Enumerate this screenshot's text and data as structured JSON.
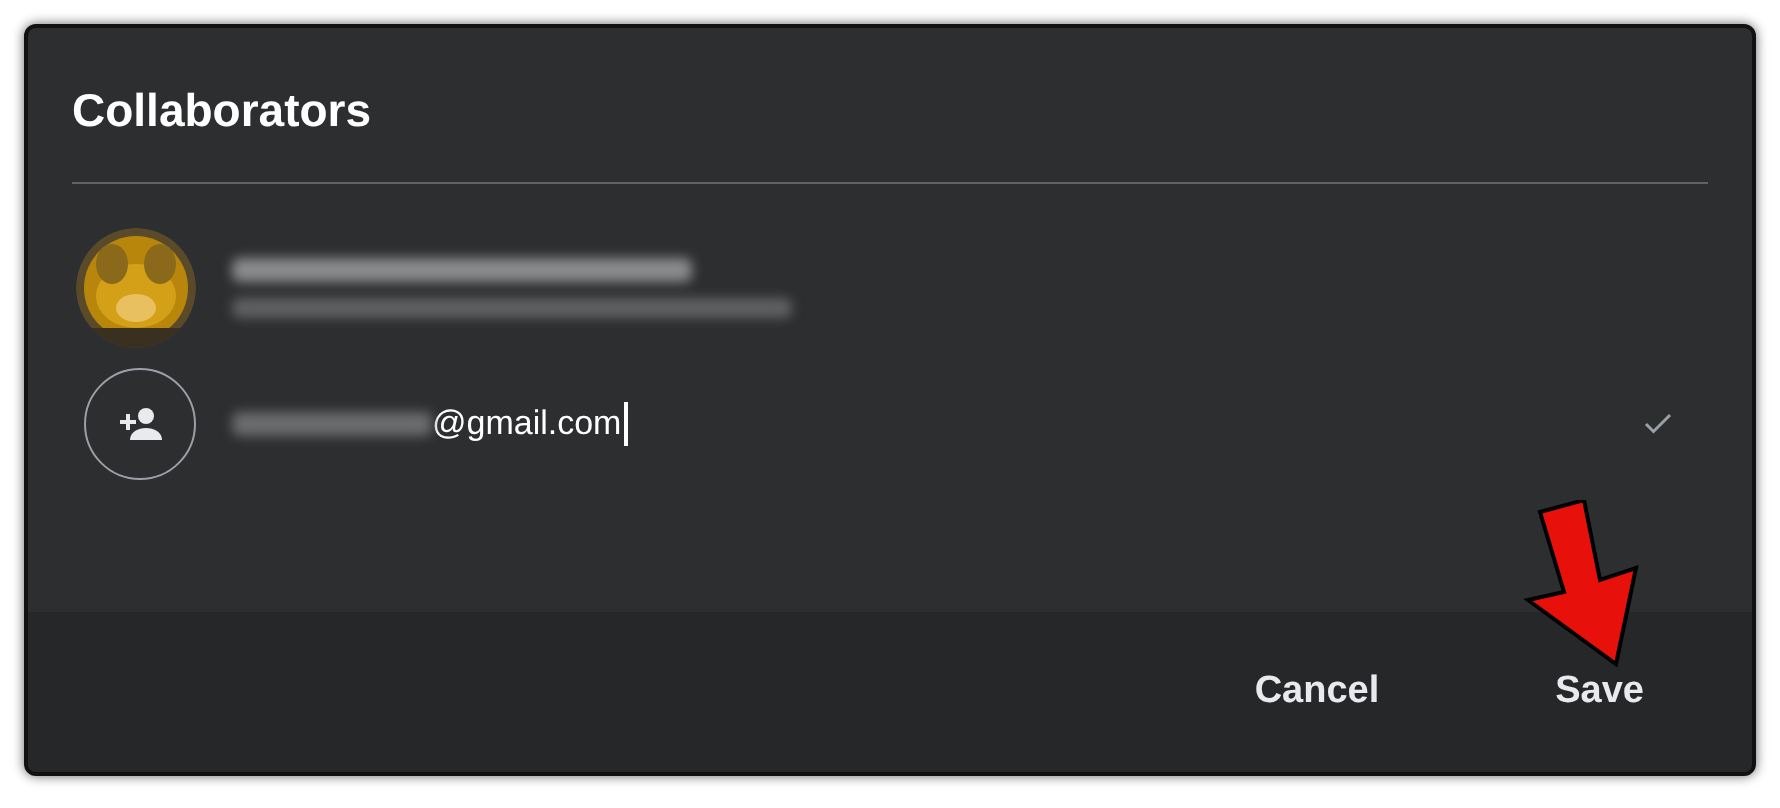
{
  "dialog": {
    "title": "Collaborators",
    "invite": {
      "value": "@gmail.com"
    },
    "buttons": [
      "Cancel",
      "Save"
    ]
  }
}
